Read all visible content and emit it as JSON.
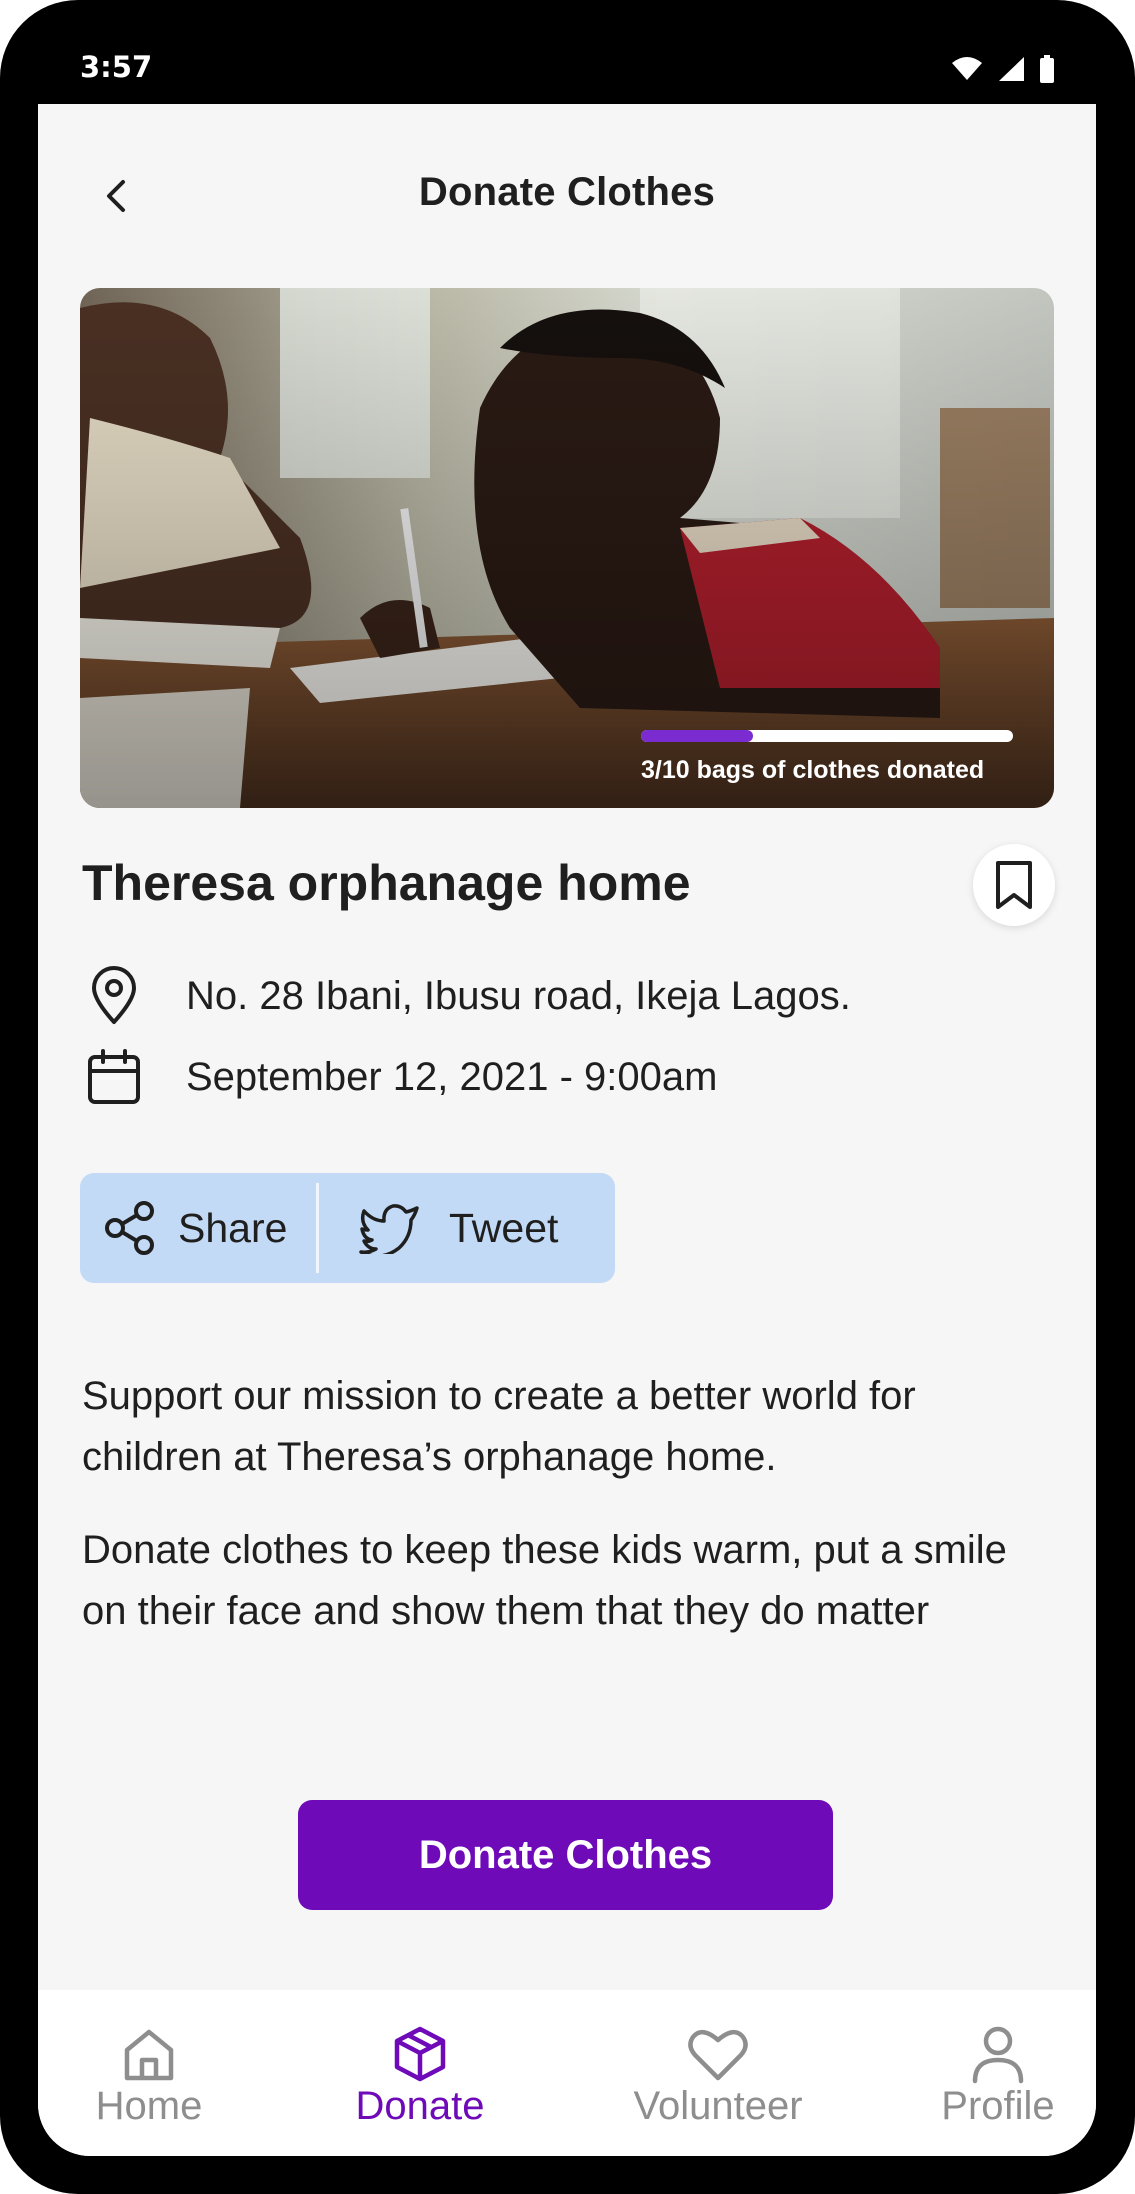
{
  "status_bar": {
    "time": "3:57"
  },
  "header": {
    "title": "Donate Clothes"
  },
  "hero": {
    "progress_fraction": 0.3,
    "progress_label": "3/10 bags of clothes donated"
  },
  "home": {
    "name": "Theresa orphanage home",
    "address": "No. 28 Ibani, Ibusu road, Ikeja Lagos.",
    "datetime": "September 12, 2021 - 9:00am"
  },
  "share": {
    "share_label": "Share",
    "tweet_label": "Tweet"
  },
  "description": {
    "paragraph_1": "Support our mission to create a better world for children at Theresa’s orphanage home.",
    "paragraph_2": "Donate clothes to keep these kids warm, put a smile on their face and show them that they do matter"
  },
  "cta": {
    "label": "Donate Clothes"
  },
  "bottom_nav": {
    "items": [
      {
        "label": "Home",
        "icon": "home-icon",
        "active": false
      },
      {
        "label": "Donate",
        "icon": "box-icon",
        "active": true
      },
      {
        "label": "Volunteer",
        "icon": "heart-icon",
        "active": false
      },
      {
        "label": "Profile",
        "icon": "person-icon",
        "active": false
      }
    ]
  },
  "colors": {
    "accent": "#6e0ab8",
    "progress": "#7a2cd1",
    "share_bg": "#c2daf5",
    "inactive_nav": "#8e8e8e",
    "screen_bg": "#f6f6f6"
  }
}
